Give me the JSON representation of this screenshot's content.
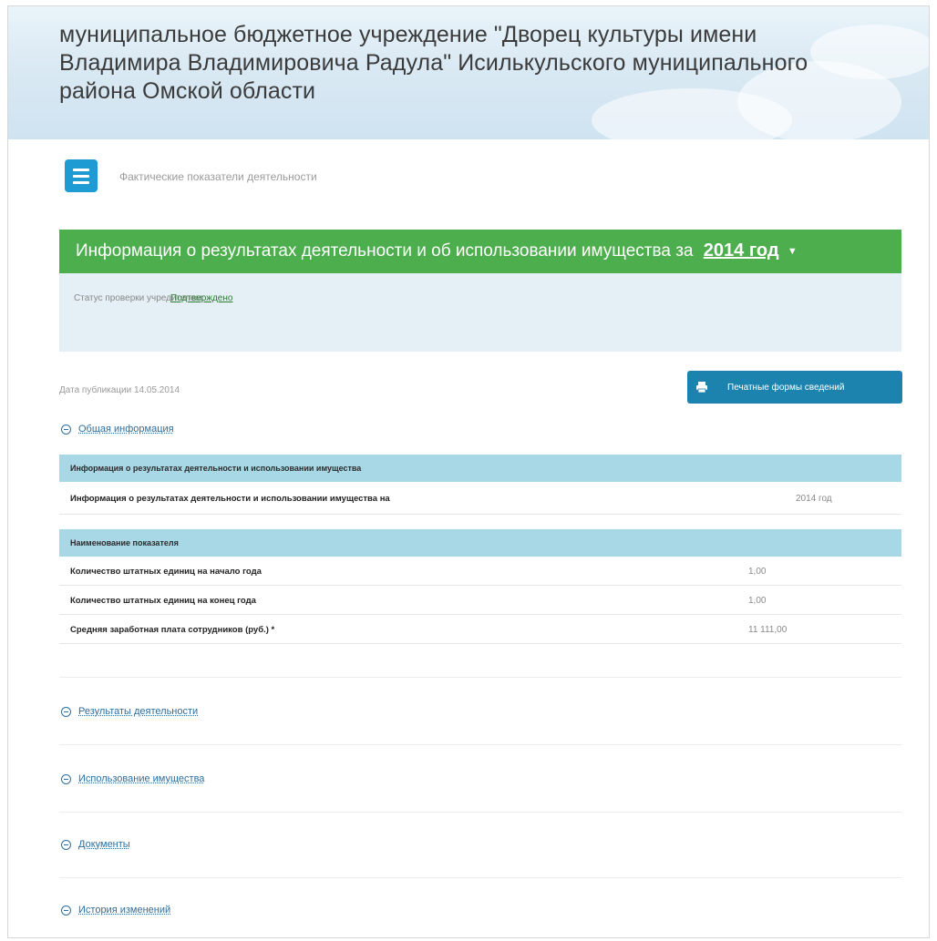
{
  "header": {
    "title": "муниципальное бюджетное учреждение \"Дворец культуры имени Владимира Владимировича Радула\" Исилькульского муниципального района Омской области"
  },
  "section": {
    "title": "Фактические показатели деятельности",
    "menu_icon": "hamburger-icon"
  },
  "banner": {
    "text": "Информация о результатах деятельности и об использовании имущества за",
    "year": "2014 год",
    "caret": "▼",
    "color": "#4cae4c"
  },
  "status": {
    "label": "Статус проверки учредителем:",
    "value": "Подтверждено"
  },
  "publication": {
    "date_text": "Дата публикации 14.05.2014"
  },
  "print_button": {
    "label": "Печатные формы сведений",
    "icon": "printer-icon"
  },
  "general": {
    "heading": "Общая информация",
    "table1_header": "Информация о результатах деятельности и использовании имущества",
    "table1_row": {
      "label": "Информация о результатах деятельности и использовании имущества на",
      "value": "2014 год"
    },
    "table2_header": "Наименование показателя",
    "rows": [
      {
        "label": "Количество штатных единиц на начало года",
        "value": "1,00"
      },
      {
        "label": "Количество штатных единиц на конец года",
        "value": "1,00"
      },
      {
        "label": "Средняя заработная плата сотрудников (руб.) *",
        "value": "11 111,00"
      }
    ]
  },
  "sections": [
    {
      "heading": "Результаты деятельности"
    },
    {
      "heading": "Использование имущества"
    },
    {
      "heading": "Документы"
    },
    {
      "heading": "История изменений"
    }
  ],
  "colors": {
    "accent": "#1e9bd3",
    "table_header": "#a8d8e6",
    "link": "#2d6e9e",
    "print_button": "#1b83ad"
  }
}
